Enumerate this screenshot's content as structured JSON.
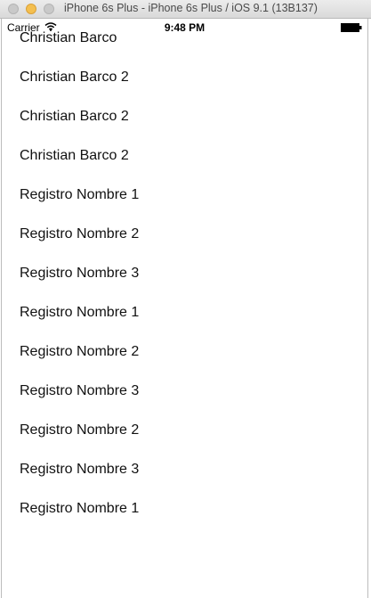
{
  "window": {
    "title": "iPhone 6s Plus - iPhone 6s Plus / iOS 9.1 (13B137)"
  },
  "status_bar": {
    "carrier": "Carrier",
    "time": "9:48 PM",
    "wifi_icon": "wifi-icon",
    "battery_icon": "battery-icon"
  },
  "list": {
    "items": [
      {
        "label": "Christian Barco"
      },
      {
        "label": "Christian Barco 2"
      },
      {
        "label": "Christian Barco 2"
      },
      {
        "label": "Christian Barco 2"
      },
      {
        "label": "Registro Nombre 1"
      },
      {
        "label": "Registro Nombre 2"
      },
      {
        "label": "Registro Nombre 3"
      },
      {
        "label": "Registro Nombre 1"
      },
      {
        "label": "Registro Nombre 2"
      },
      {
        "label": "Registro Nombre 3"
      },
      {
        "label": "Registro Nombre 2"
      },
      {
        "label": "Registro Nombre 3"
      },
      {
        "label": "Registro Nombre 1"
      }
    ]
  },
  "colors": {
    "background": "#ffffff",
    "text": "#111111",
    "minimize_button": "#f4bf4f"
  }
}
